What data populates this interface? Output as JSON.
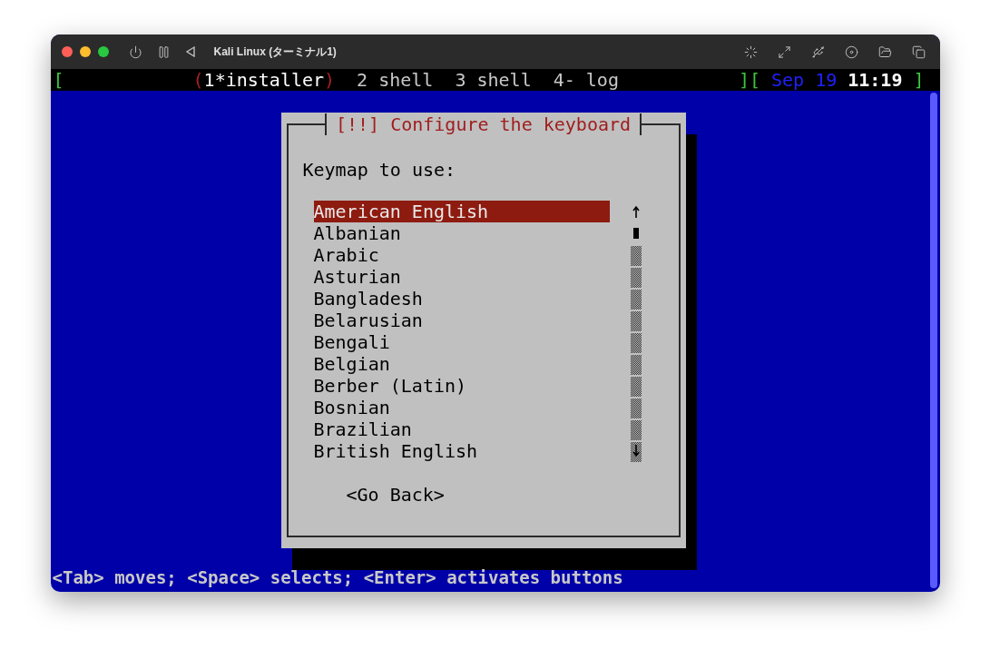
{
  "window": {
    "title": "Kali Linux (ターミナル1)"
  },
  "screen_bar": {
    "open_bracket": "[",
    "tabs": [
      {
        "label": "1*installer",
        "open_paren": "(",
        "close_paren": ")",
        "selected": true
      },
      {
        "label": "2 shell",
        "selected": false
      },
      {
        "label": "3 shell",
        "selected": false
      },
      {
        "label": "4- log",
        "selected": false
      }
    ],
    "mid_brackets": "][",
    "date": "Sep 19",
    "time": "11:19",
    "close_bracket": "]"
  },
  "dialog": {
    "title": "[!!] Configure the keyboard",
    "prompt": "Keymap to use:",
    "items": [
      {
        "label": "American English",
        "selected": true
      },
      {
        "label": "Albanian",
        "selected": false
      },
      {
        "label": "Arabic",
        "selected": false
      },
      {
        "label": "Asturian",
        "selected": false
      },
      {
        "label": "Bangladesh",
        "selected": false
      },
      {
        "label": "Belarusian",
        "selected": false
      },
      {
        "label": "Bengali",
        "selected": false
      },
      {
        "label": "Belgian",
        "selected": false
      },
      {
        "label": "Berber (Latin)",
        "selected": false
      },
      {
        "label": "Bosnian",
        "selected": false
      },
      {
        "label": "Brazilian",
        "selected": false
      },
      {
        "label": "British English",
        "selected": false
      }
    ],
    "back_button": "<Go Back>"
  },
  "status_line": "<Tab> moves; <Space> selects; <Enter> activates buttons"
}
